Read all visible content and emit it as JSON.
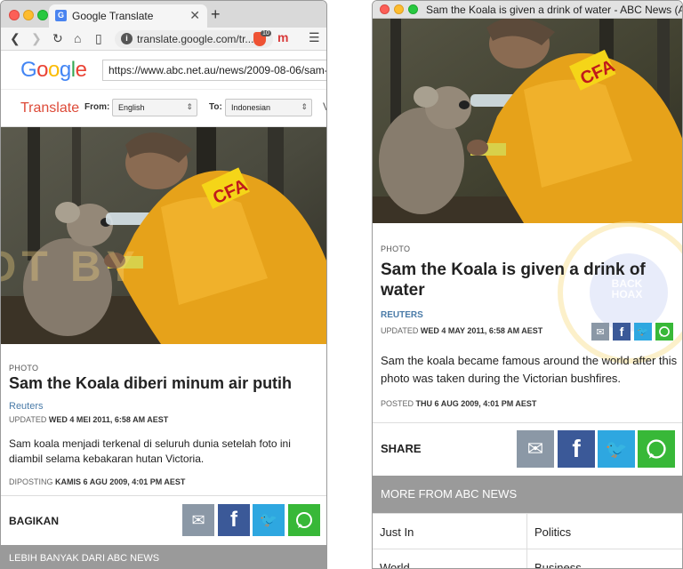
{
  "left": {
    "tab_title": "Google Translate",
    "url": "translate.google.com/tr...",
    "brave_count": "10",
    "google_url": "https://www.abc.net.au/news/2009-08-06/sam-th",
    "translate_label": "Translate",
    "from_label": "From:",
    "from_value": "English",
    "to_label": "To:",
    "to_value": "Indonesian",
    "kicker": "PHOTO",
    "headline": "Sam the Koala diberi minum air putih",
    "source": "Reuters",
    "updated_label": "UPDATED",
    "updated_value": "WED 4 MEI 2011, 6:58 AM AEST",
    "body": "Sam koala menjadi terkenal di seluruh dunia setelah foto ini diambil selama kebakaran hutan Victoria.",
    "posted_label": "DIPOSTING",
    "posted_value": "KAMIS 6 AGU 2009, 4:01 PM AEST",
    "share_label": "BAGIKAN",
    "more_label": "LEBIH BANYAK DARI ABC NEWS"
  },
  "right": {
    "window_title": "Sam the Koala is given a drink of water - ABC News (Au...",
    "kicker": "PHOTO",
    "headline": "Sam the Koala is given a drink of water",
    "source": "REUTERS",
    "updated_label": "UPDATED",
    "updated_value": "WED 4 MAY 2011, 6:58 AM AEST",
    "body": "Sam the koala became famous around the world after this photo was taken during the Victorian bushfires.",
    "posted_label": "POSTED",
    "posted_value": "THU 6 AUG 2009, 4:01 PM AEST",
    "share_label": "SHARE",
    "more_label": "MORE FROM ABC NEWS",
    "grid": [
      [
        "Just In",
        "Politics"
      ],
      [
        "World",
        "Business"
      ]
    ]
  },
  "logo_letters": [
    "G",
    "o",
    "o",
    "g",
    "l",
    "e"
  ],
  "patch_text": "CFA",
  "watermark_texts": [
    "OT BY",
    "BACK",
    "HOAX"
  ],
  "icons": [
    "mail-icon",
    "facebook-icon",
    "twitter-icon",
    "whatsapp-icon"
  ],
  "colors": {
    "facebook": "#3b5998",
    "twitter": "#2ea7e0",
    "whatsapp": "#38b838",
    "mail": "#8b98a6",
    "translate": "#dd4b39",
    "link": "#4a7ba8"
  }
}
